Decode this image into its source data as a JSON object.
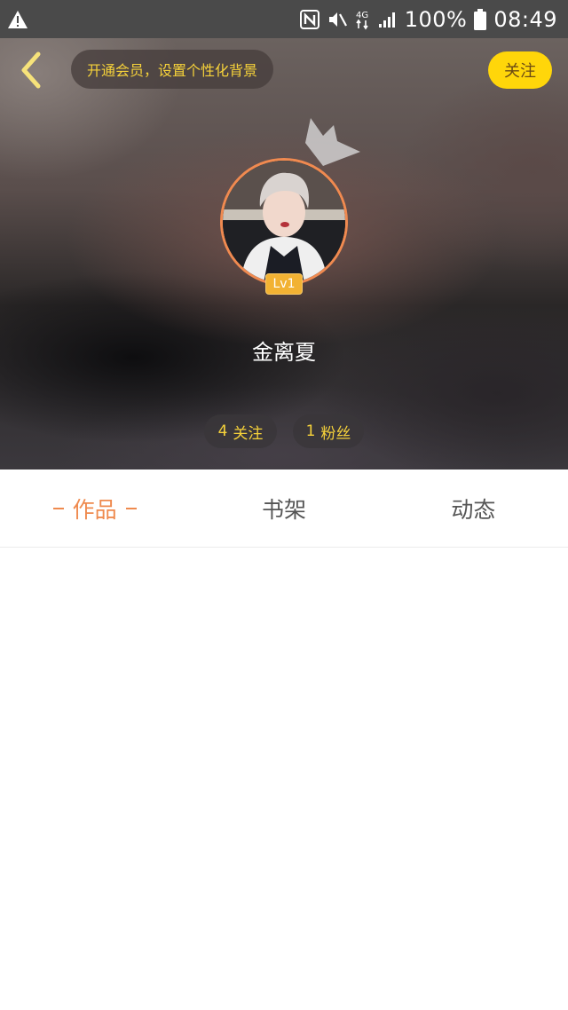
{
  "status_bar": {
    "battery": "100%",
    "time": "08:49",
    "network": "4G",
    "icons": [
      "warning-icon",
      "nfc-icon",
      "mute-icon",
      "network-4g-icon",
      "signal-icon",
      "battery-icon"
    ]
  },
  "header": {
    "vip_banner": "开通会员，设置个性化背景",
    "follow_label": "关注",
    "level": "Lv1",
    "username": "金离夏",
    "stats": {
      "following_count": "4",
      "following_label": "关注",
      "fans_count": "1",
      "fans_label": "粉丝"
    }
  },
  "tabs": [
    {
      "label": "作品",
      "active": true
    },
    {
      "label": "书架",
      "active": false
    },
    {
      "label": "动态",
      "active": false
    }
  ],
  "colors": {
    "accent_orange": "#ef8a4e",
    "follow_yellow": "#ffd60a",
    "banner_text_yellow": "#f6d23a",
    "status_bar": "#4a4a4a"
  }
}
